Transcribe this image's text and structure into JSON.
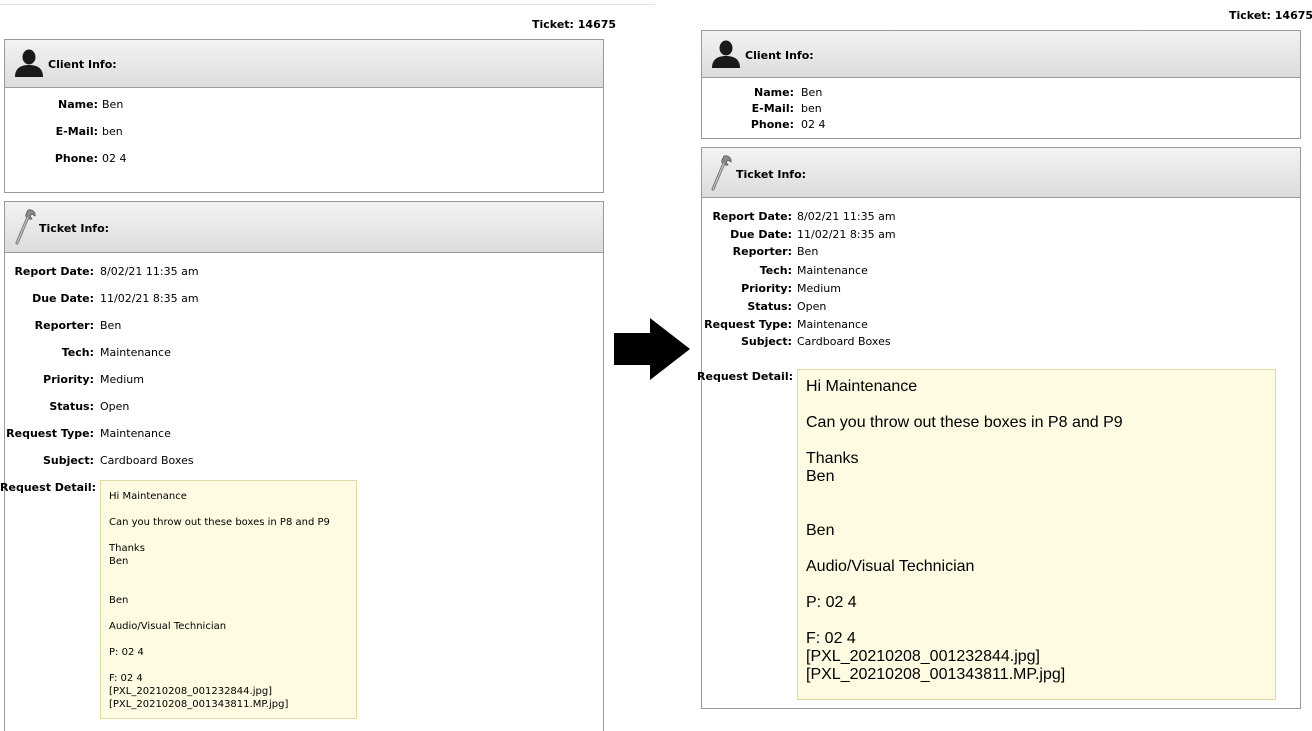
{
  "ticket": {
    "label": "Ticket: 14675"
  },
  "client_info": {
    "title": "Client Info:",
    "fields": [
      {
        "label": "Name:",
        "value": "Ben"
      },
      {
        "label": "E-Mail:",
        "value": "ben"
      },
      {
        "label": "Phone:",
        "value": "02 4"
      }
    ]
  },
  "ticket_info": {
    "title": "Ticket Info:",
    "fields": [
      {
        "label": "Report Date:",
        "value": "8/02/21 11:35 am"
      },
      {
        "label": "Due Date:",
        "value": "11/02/21 8:35 am"
      },
      {
        "label": "Reporter:",
        "value": "Ben"
      },
      {
        "label": "Tech:",
        "value": "Maintenance"
      },
      {
        "label": "Priority:",
        "value": "Medium"
      },
      {
        "label": "Status:",
        "value": "Open"
      },
      {
        "label": "Request Type:",
        "value": "Maintenance"
      },
      {
        "label": "Subject:",
        "value": "Cardboard Boxes"
      }
    ],
    "request_detail_label": "Request Detail:",
    "request_detail": "Hi Maintenance\n\nCan you throw out these boxes in P8 and P9\n\nThanks\nBen\n\n\nBen\n\nAudio/Visual Technician\n\nP: 02 4\n\nF: 02 4\n[PXL_20210208_001232844.jpg]\n[PXL_20210208_001343811.MP.jpg]"
  },
  "icons": {
    "client": "user-silhouette-icon",
    "ticket": "wrench-icon",
    "transition": "right-arrow-icon"
  },
  "colors": {
    "detail_background": "#fffbe2",
    "panel_border": "#9a9a9a",
    "header_gradient_top": "#f3f3f3",
    "header_gradient_bottom": "#dcdcdc"
  }
}
